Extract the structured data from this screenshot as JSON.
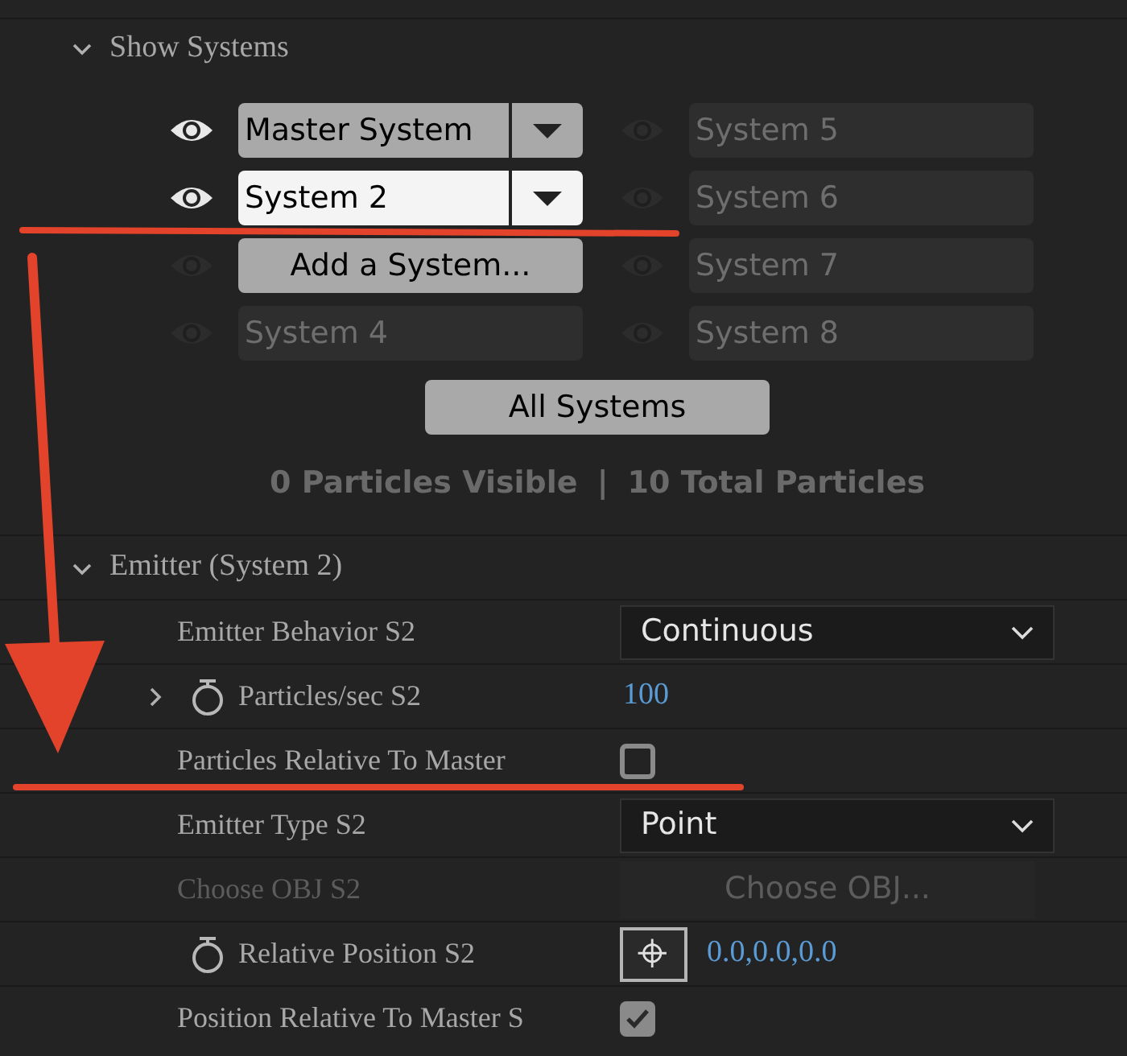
{
  "systems_section": {
    "title": "Show Systems",
    "expanded": true
  },
  "systems": [
    {
      "kind": "dropdown",
      "label": "Master System",
      "visible": true,
      "selected": false
    },
    {
      "kind": "empty",
      "label": "System 5",
      "visible": false,
      "selected": false
    },
    {
      "kind": "dropdown",
      "label": "System 2",
      "visible": true,
      "selected": true
    },
    {
      "kind": "empty",
      "label": "System 6",
      "visible": false,
      "selected": false
    },
    {
      "kind": "button",
      "label": "Add a System...",
      "visible": false,
      "selected": false
    },
    {
      "kind": "empty",
      "label": "System 7",
      "visible": false,
      "selected": false
    },
    {
      "kind": "empty",
      "label": "System 4",
      "visible": false,
      "selected": false
    },
    {
      "kind": "empty",
      "label": "System 8",
      "visible": false,
      "selected": false
    }
  ],
  "all_systems_button": "All Systems",
  "stats": {
    "visible": "0 Particles Visible",
    "separator": "|",
    "total": "10 Total Particles"
  },
  "emitter": {
    "title": "Emitter (System 2)",
    "expanded": true,
    "rows": [
      {
        "kind": "dropdown",
        "label": "Emitter Behavior S2",
        "value": "Continuous",
        "animatable": false,
        "expandable": false,
        "disabled": false
      },
      {
        "kind": "number",
        "label": "Particles/sec S2",
        "value": "100",
        "animatable": true,
        "expandable": true,
        "disabled": false
      },
      {
        "kind": "checkbox",
        "label": "Particles Relative To Master",
        "checked": false,
        "animatable": false,
        "expandable": false,
        "disabled": false
      },
      {
        "kind": "dropdown",
        "label": "Emitter Type S2",
        "value": "Point",
        "animatable": false,
        "expandable": false,
        "disabled": false
      },
      {
        "kind": "button",
        "label": "Choose OBJ S2",
        "value": "Choose OBJ...",
        "animatable": false,
        "expandable": false,
        "disabled": true
      },
      {
        "kind": "point",
        "label": "Relative Position S2",
        "value": "0.0,0.0,0.0",
        "animatable": true,
        "expandable": false,
        "disabled": false
      },
      {
        "kind": "checkbox",
        "label": "Position Relative To Master S",
        "checked": true,
        "animatable": false,
        "expandable": false,
        "disabled": false
      }
    ]
  }
}
